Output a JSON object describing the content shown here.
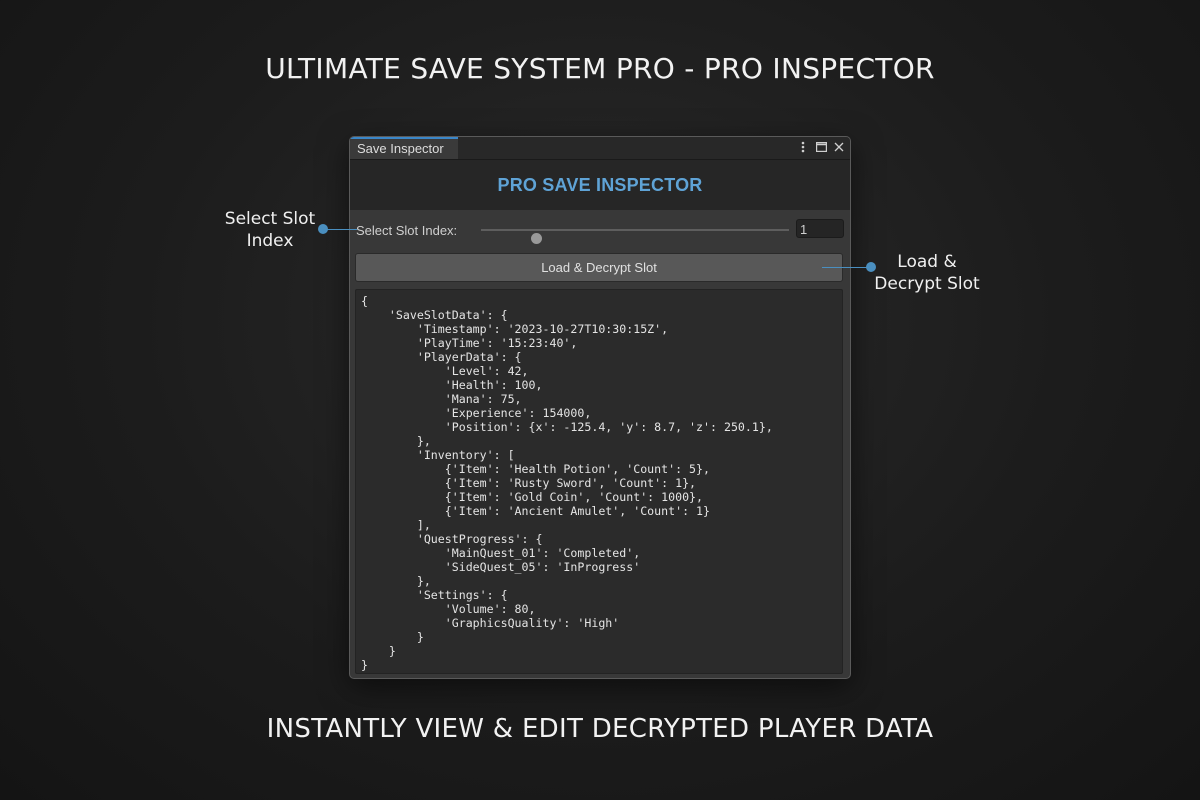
{
  "headline": "ULTIMATE SAVE SYSTEM PRO - PRO INSPECTOR",
  "footer": "INSTANTLY VIEW & EDIT DECRYPTED PLAYER DATA",
  "window": {
    "tab_label": "Save Inspector",
    "controls": [
      "more-options-icon",
      "maximize-icon",
      "close-icon"
    ],
    "title": "PRO SAVE INSPECTOR",
    "slot": {
      "label": "Select Slot Index:",
      "value": "1",
      "slider_fraction": 0.18
    },
    "load_button": "Load & Decrypt Slot",
    "code_lines": [
      "{",
      "    'SaveSlotData': {",
      "        'Timestamp': '2023-10-27T10:30:15Z',",
      "        'PlayTime': '15:23:40',",
      "        'PlayerData': {",
      "            'Level': 42,",
      "            'Health': 100,",
      "            'Mana': 75,",
      "            'Experience': 154000,",
      "            'Position': {x': -125.4, 'y': 8.7, 'z': 250.1},",
      "        },",
      "        'Inventory': [",
      "            {'Item': 'Health Potion', 'Count': 5},",
      "            {'Item': 'Rusty Sword', 'Count': 1},",
      "            {'Item': 'Gold Coin', 'Count': 1000},",
      "            {'Item': 'Ancient Amulet', 'Count': 1}",
      "        ],",
      "        'QuestProgress': {",
      "            'MainQuest_01': 'Completed',",
      "            'SideQuest_05': 'InProgress'",
      "        },",
      "        'Settings': {",
      "            'Volume': 80,",
      "            'GraphicsQuality': 'High'",
      "        }",
      "    }",
      "}"
    ]
  },
  "callouts": {
    "left": "Select Slot\nIndex",
    "right": "Load &\nDecrypt Slot",
    "color": "#4a8fc0"
  },
  "colors": {
    "accent_title": "#5fa3d6",
    "tab_highlight": "#3a86c8"
  }
}
